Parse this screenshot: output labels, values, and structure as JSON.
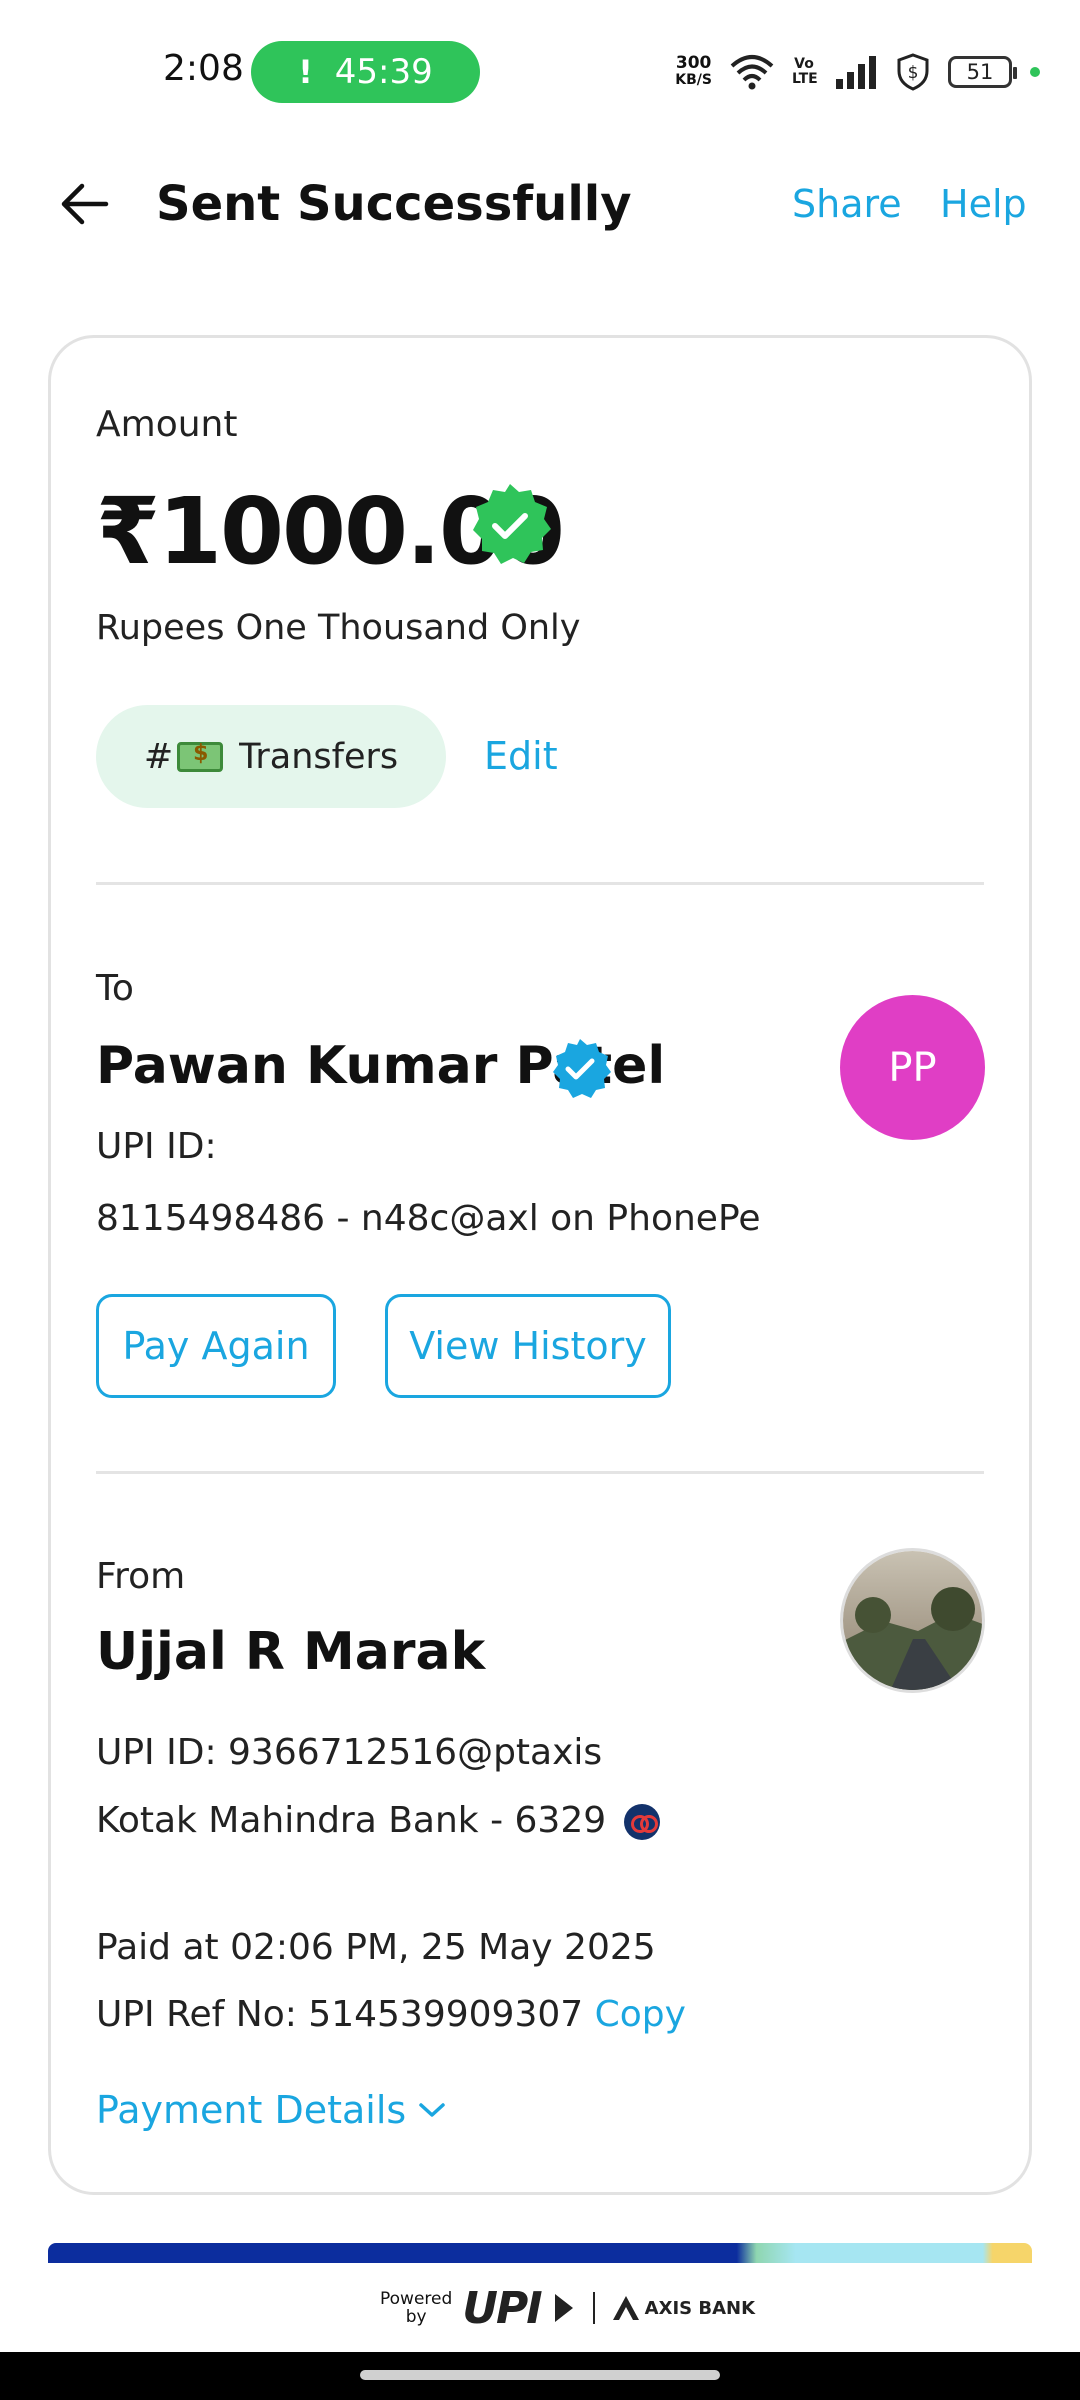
{
  "status_bar": {
    "time": "2:08",
    "call_timer": "45:39",
    "call_indicator": "!",
    "net_speed_value": "300",
    "net_speed_unit": "KB/S",
    "volte": "Vo LTE",
    "battery": "51"
  },
  "header": {
    "title": "Sent Successfully",
    "share_label": "Share",
    "help_label": "Help"
  },
  "amount_section": {
    "label": "Amount",
    "amount": "₹1000.00",
    "amount_in_words": "Rupees One Thousand Only",
    "tag_prefix": "#",
    "tag_label": "Transfers",
    "edit_label": "Edit"
  },
  "to_section": {
    "label": "To",
    "name": "Pawan Kumar Patel",
    "avatar_initials": "PP",
    "upi_label": "UPI ID:",
    "upi_detail": "8115498486 - n48c@axl on PhonePe",
    "pay_again_label": "Pay Again",
    "view_history_label": "View History"
  },
  "from_section": {
    "label": "From",
    "name": "Ujjal R Marak",
    "upi_id": "UPI ID: 9366712516@ptaxis",
    "bank": "Kotak Mahindra Bank - 6329"
  },
  "transaction": {
    "paid_at": "Paid at 02:06 PM, 25 May 2025",
    "ref_text": "UPI Ref No: 514539909307",
    "copy_label": "Copy",
    "payment_details_label": "Payment Details"
  },
  "footer": {
    "powered_line1": "Powered",
    "powered_line2": "by",
    "upi": "UPI",
    "bank_name": "AXIS BANK"
  },
  "colors": {
    "accent_blue": "#1aa6e0",
    "success_green": "#2fc45a",
    "avatar_magenta": "#e03ec5"
  }
}
